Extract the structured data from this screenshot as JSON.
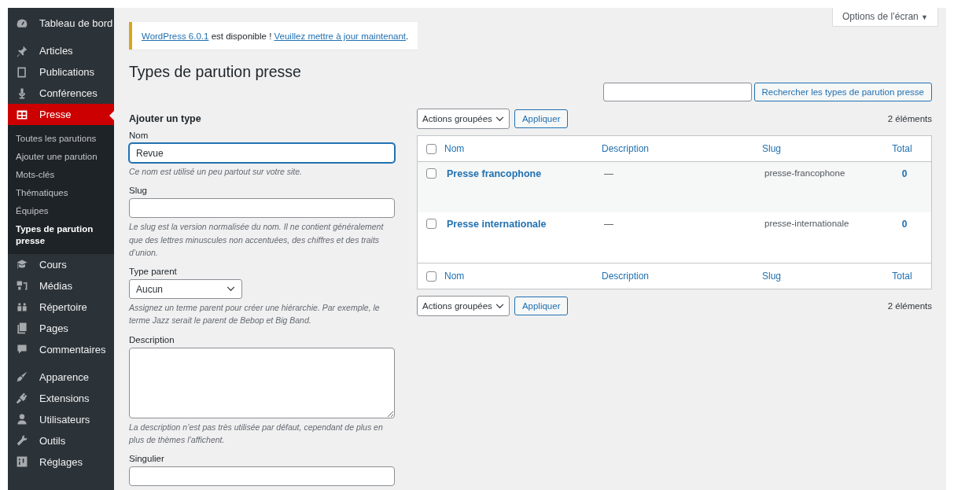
{
  "sidebar": {
    "groups": [
      {
        "items": [
          {
            "label": "Tableau de bord",
            "selected": false
          }
        ]
      },
      {
        "items": [
          {
            "label": "Articles",
            "selected": false
          },
          {
            "label": "Publications",
            "selected": false
          },
          {
            "label": "Conférences",
            "selected": false
          },
          {
            "label": "Presse",
            "selected": true,
            "children": [
              {
                "label": "Toutes les parutions",
                "selected": false
              },
              {
                "label": "Ajouter une parution",
                "selected": false
              },
              {
                "label": "Mots-clés",
                "selected": false
              },
              {
                "label": "Thématiques",
                "selected": false
              },
              {
                "label": "Équipes",
                "selected": false
              },
              {
                "label": "Types de parution presse",
                "selected": true
              }
            ]
          },
          {
            "label": "Cours",
            "selected": false
          },
          {
            "label": "Médias",
            "selected": false
          },
          {
            "label": "Répertoire",
            "selected": false
          },
          {
            "label": "Pages",
            "selected": false
          },
          {
            "label": "Commentaires",
            "selected": false
          }
        ]
      },
      {
        "items": [
          {
            "label": "Apparence",
            "selected": false
          },
          {
            "label": "Extensions",
            "selected": false
          },
          {
            "label": "Utilisateurs",
            "selected": false
          },
          {
            "label": "Outils",
            "selected": false
          },
          {
            "label": "Réglages",
            "selected": false
          }
        ]
      }
    ]
  },
  "screen_options": {
    "label": "Options de l’écran",
    "caret": "▼"
  },
  "notice": {
    "link": "WordPress 6.0.1",
    "text": " est disponible ! ",
    "action": "Veuillez mettre à jour maintenant",
    "end": "."
  },
  "title": "Types de parution presse",
  "form": {
    "heading": "Ajouter un type",
    "fields": [
      {
        "kind": "text",
        "label": "Nom",
        "value": "Revue",
        "focused": true,
        "help": "Ce nom est utilisé un peu partout sur votre site."
      },
      {
        "kind": "text",
        "label": "Slug",
        "focused": false,
        "help": "Le slug est la version normalisée du nom. Il ne contient généralement que des lettres minuscules non accentuées, des chiffres et des traits d’union."
      },
      {
        "kind": "select",
        "label": "Type parent",
        "value": "Aucun",
        "help": "Assignez un terme parent pour créer une hiérarchie. Par exemple, le terme Jazz serait le parent de Bebop et Big Band."
      },
      {
        "kind": "textarea",
        "label": "Description",
        "focused": false,
        "help": "La description n’est pas très utilisée par défaut, cependant de plus en plus de thèmes l’affichent."
      },
      {
        "kind": "text",
        "label": "Singulier",
        "focused": false
      }
    ]
  },
  "search": {
    "button": "Rechercher les types de parution presse"
  },
  "bulk_top": {
    "select": "Actions groupées",
    "apply": "Appliquer",
    "count": "2 éléments"
  },
  "table": {
    "header_checked": false,
    "columns": [
      "Nom",
      "Description",
      "Slug",
      "Total"
    ],
    "footer_checked": false,
    "footer_columns": [
      "Nom",
      "Description",
      "Slug",
      "Total"
    ],
    "rows": [
      {
        "name": "Presse francophone",
        "description": "—",
        "slug": "presse-francophone",
        "total": "0",
        "checked": false
      },
      {
        "name": "Presse internationale",
        "description": "—",
        "slug": "presse-internationale",
        "total": "0",
        "checked": false
      }
    ]
  },
  "bulk_bottom": {
    "select": "Actions groupées",
    "apply": "Appliquer",
    "count": "2 éléments"
  }
}
